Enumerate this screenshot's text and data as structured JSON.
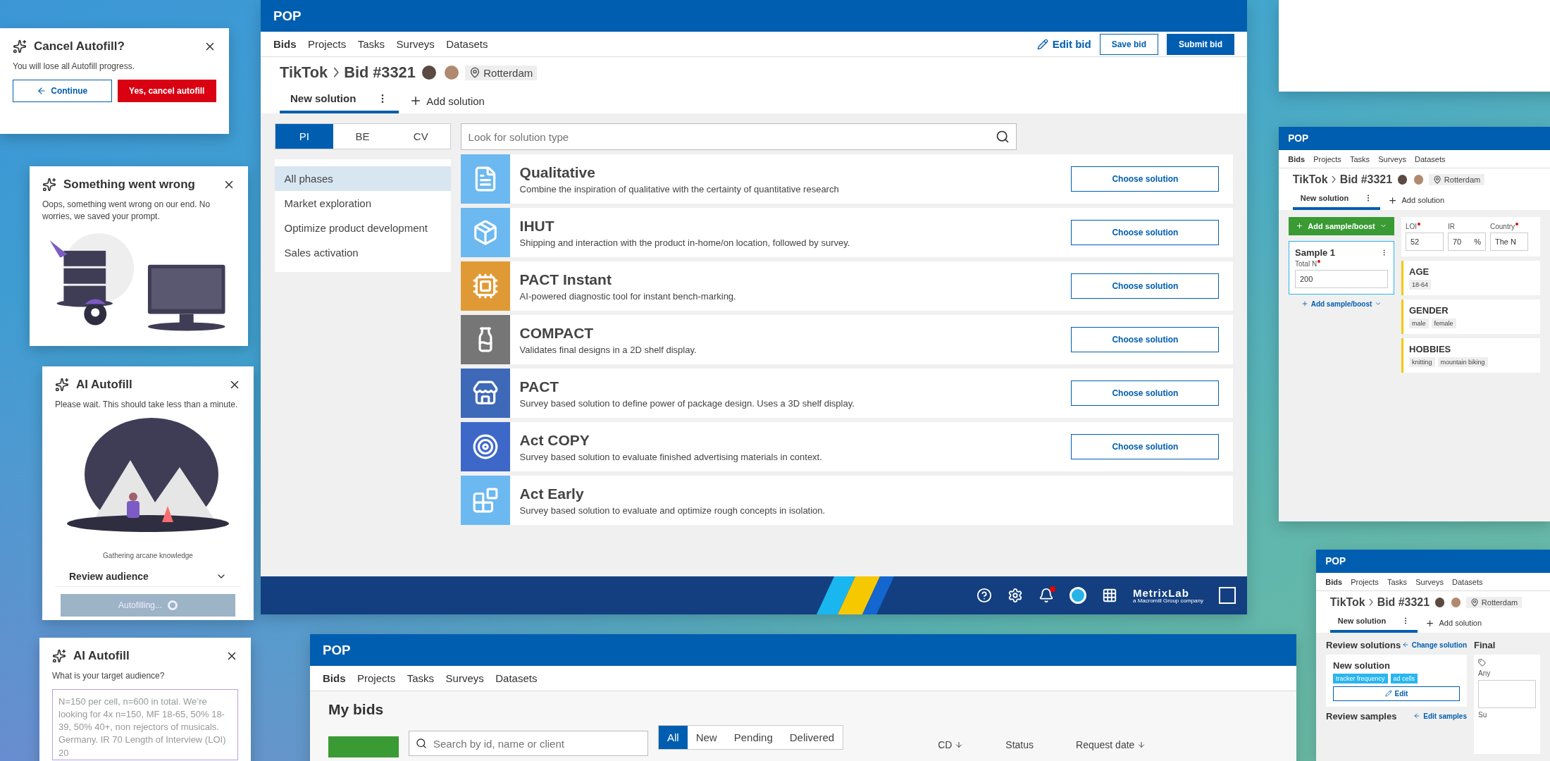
{
  "dialogs": [
    {
      "kind": "confirm",
      "title": "Cancel Autofill?",
      "message": "You will lose all Autofill progress.",
      "buttons": [
        {
          "label": "Continue",
          "kind": "secondary"
        },
        {
          "label": "Yes, cancel autofill",
          "kind": "danger"
        }
      ]
    },
    {
      "kind": "error",
      "title": "Something went wrong",
      "message": "Oops, something went wrong on our end. No worries, we saved your prompt."
    },
    {
      "kind": "loading",
      "title": "AI Autofill",
      "message": "Please wait. This should take less than a minute.",
      "caption": "Gathering arcane knowledge",
      "section": "Review audience",
      "button": "Autofilling..."
    },
    {
      "kind": "question",
      "title": "AI Autofill",
      "question": "What is your target audience?",
      "answer": "N=150 per cell, n=600 in total. We’re looking for 4x n=150, MF 18-65, 50% 18-39, 50% 40+, non rejectors of musicals. Germany. IR 70 Length of Interview (LOI) 20"
    }
  ],
  "main": {
    "app": "POP",
    "nav": [
      {
        "label": "Bids",
        "selected": true
      },
      {
        "label": "Projects",
        "selected": false
      },
      {
        "label": "Tasks",
        "selected": false
      },
      {
        "label": "Surveys",
        "selected": false
      },
      {
        "label": "Datasets",
        "selected": false
      }
    ],
    "actions": {
      "edit": "Edit bid",
      "save": "Save bid",
      "submit": "Submit bid"
    },
    "client": "TikTok",
    "bid": "Bid #3321",
    "location": "Rotterdam",
    "tabs": [
      {
        "label": "New solution",
        "selected": true
      }
    ],
    "add_tab": "Add solution",
    "segments": [
      {
        "label": "PI",
        "selected": true
      },
      {
        "label": "BE",
        "selected": false
      },
      {
        "label": "CV",
        "selected": false
      }
    ],
    "phases": [
      {
        "label": "All phases",
        "selected": true
      },
      {
        "label": "Market exploration",
        "selected": false
      },
      {
        "label": "Optimize product development",
        "selected": false
      },
      {
        "label": "Sales activation",
        "selected": false
      }
    ],
    "search": {
      "placeholder": "Look for solution type"
    },
    "solutions": [
      {
        "title": "Qualitative",
        "description": "Combine the inspiration of qualitative with the certainty of quantitative research",
        "color": "#6cb8f0",
        "action": "Choose solution"
      },
      {
        "title": "IHUT",
        "description": "Shipping and interaction with the product in-home/on location, followed by survey.",
        "color": "#6cb8f0",
        "action": "Choose solution"
      },
      {
        "title": "PACT Instant",
        "description": "AI-powered diagnostic tool for instant bench-marking.",
        "color": "#e09a35",
        "action": "Choose solution"
      },
      {
        "title": "COMPACT",
        "description": "Validates final designs in a 2D shelf display.",
        "color": "#767676",
        "action": "Choose solution"
      },
      {
        "title": "PACT",
        "description": "Survey based solution to define power of package design. Uses a 3D shelf display.",
        "color": "#3e68b8",
        "action": "Choose solution"
      },
      {
        "title": "Act COPY",
        "description": "Survey based solution to evaluate finished advertising materials in context.",
        "color": "#3e68c8",
        "action": "Choose solution"
      },
      {
        "title": "Act Early",
        "description": "Survey based solution to evaluate and optimize rough concepts in isolation.",
        "color": "#6cb8f0"
      }
    ],
    "footer": {
      "notifications": true,
      "brand": "MetrixLab",
      "tagline": "a Macromill Group company"
    }
  },
  "bids_panel": {
    "app": "POP",
    "nav": [
      {
        "label": "Bids",
        "selected": true
      },
      {
        "label": "Projects",
        "selected": false
      },
      {
        "label": "Tasks",
        "selected": false
      },
      {
        "label": "Surveys",
        "selected": false
      },
      {
        "label": "Datasets",
        "selected": false
      }
    ],
    "title": "My bids",
    "search": {
      "placeholder": "Search by id, name or client"
    },
    "filters": [
      {
        "label": "All",
        "selected": true
      },
      {
        "label": "New",
        "selected": false
      },
      {
        "label": "Pending",
        "selected": false
      },
      {
        "label": "Delivered",
        "selected": false
      }
    ],
    "columns": [
      {
        "label": "CD",
        "sortable": true
      },
      {
        "label": "Status",
        "sortable": false
      },
      {
        "label": "Request date",
        "sortable": true
      }
    ]
  },
  "sample_panel": {
    "app": "POP",
    "nav": [
      {
        "label": "Bids",
        "selected": true
      },
      {
        "label": "Projects",
        "selected": false
      },
      {
        "label": "Tasks",
        "selected": false
      },
      {
        "label": "Surveys",
        "selected": false
      },
      {
        "label": "Datasets",
        "selected": false
      }
    ],
    "client": "TikTok",
    "bid": "Bid #3321",
    "location": "Rotterdam",
    "tabs": [
      {
        "label": "New solution",
        "selected": true
      }
    ],
    "add_tab": "Add solution",
    "add_button": "Add sample/boost",
    "sample": {
      "title": "Sample 1",
      "label": "Total N",
      "required": true,
      "value": "200"
    },
    "add_link": "Add sample/boost",
    "fields": [
      {
        "label": "LOI",
        "required": true,
        "value": "52"
      },
      {
        "label": "IR",
        "required": false,
        "value": "70",
        "unit": "%"
      },
      {
        "label": "Country",
        "required": true,
        "value": "The N"
      }
    ],
    "criteria": [
      {
        "title": "AGE",
        "tags": [
          "18-64"
        ]
      },
      {
        "title": "GENDER",
        "tags": [
          "male",
          "female"
        ]
      },
      {
        "title": "HOBBIES",
        "tags": [
          "knitting",
          "mountain biking"
        ]
      }
    ]
  },
  "review_panel": {
    "app": "POP",
    "nav": [
      {
        "label": "Bids",
        "selected": true
      },
      {
        "label": "Projects",
        "selected": false
      },
      {
        "label": "Tasks",
        "selected": false
      },
      {
        "label": "Surveys",
        "selected": false
      },
      {
        "label": "Datasets",
        "selected": false
      }
    ],
    "client": "TikTok",
    "bid": "Bid #3321",
    "location": "Rotterdam",
    "tabs": [
      {
        "label": "New solution",
        "selected": true
      }
    ],
    "add_tab": "Add solution",
    "solutions_heading": "Review solutions",
    "change_link": "Change solution",
    "solution": {
      "title": "New solution",
      "tags": [
        "tracker frequency",
        "ad cells"
      ],
      "edit": "Edit"
    },
    "samples_heading": "Review samples",
    "samples_link": "Edit samples",
    "final_heading": "Final",
    "field_label": "Any",
    "field_label_2": "Su"
  }
}
